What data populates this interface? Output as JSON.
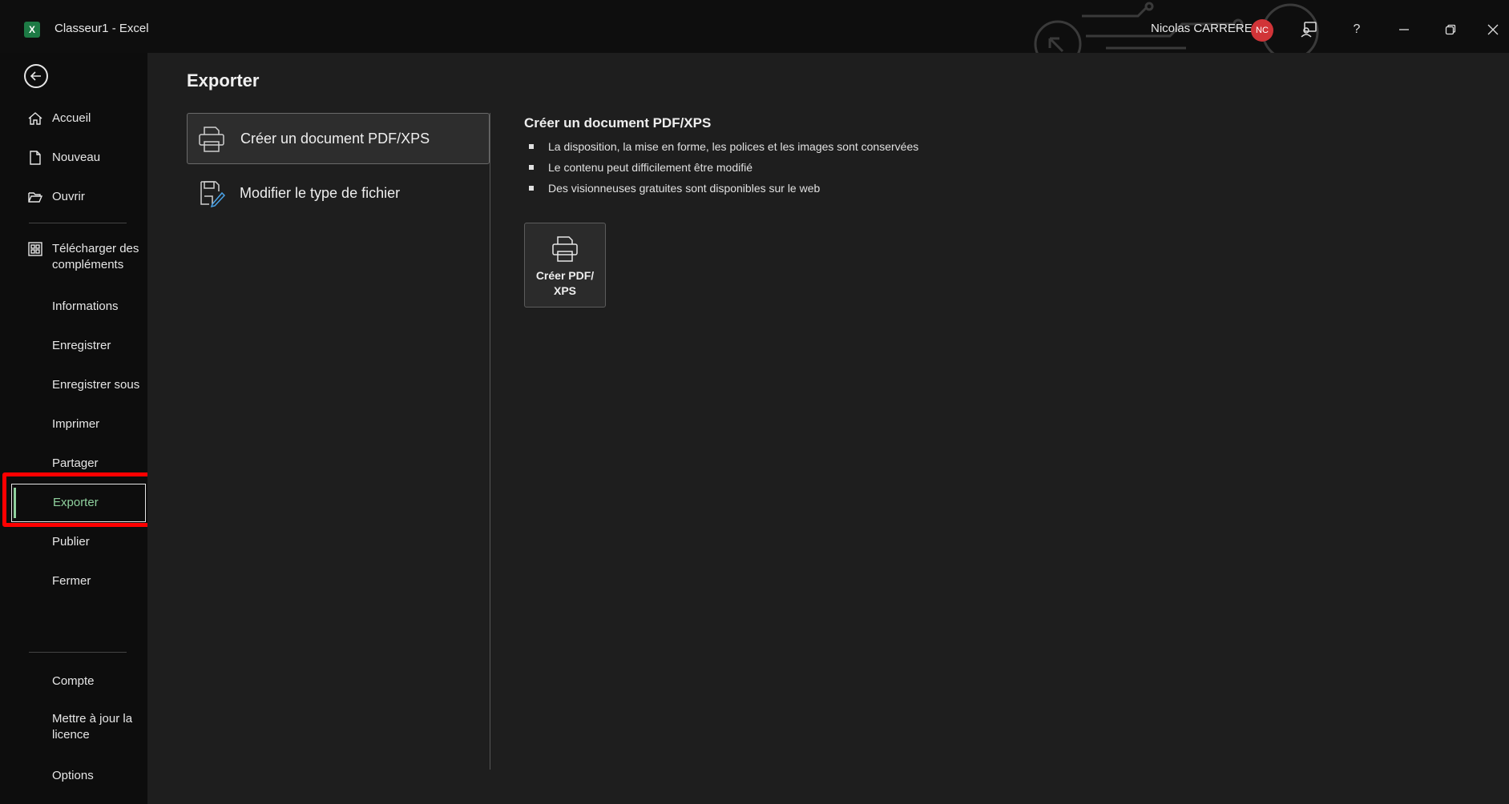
{
  "titlebar": {
    "app_logo": "X",
    "title": "Classeur1  -  Excel",
    "user_name": "Nicolas CARRERE",
    "avatar_initials": "NC",
    "help_label": "?"
  },
  "sidebar": {
    "items": [
      {
        "label": "Accueil",
        "icon": "home-icon"
      },
      {
        "label": "Nouveau",
        "icon": "new-document-icon"
      },
      {
        "label": "Ouvrir",
        "icon": "folder-open-icon"
      },
      {
        "label_line1": "Télécharger des",
        "label_line2": "compléments",
        "icon": "addins-icon"
      },
      {
        "label": "Informations"
      },
      {
        "label": "Enregistrer"
      },
      {
        "label": "Enregistrer sous"
      },
      {
        "label": "Imprimer"
      },
      {
        "label": "Partager"
      },
      {
        "label": "Exporter",
        "active": true
      },
      {
        "label": "Publier"
      },
      {
        "label": "Fermer"
      }
    ],
    "bottom_items": [
      {
        "label": "Compte"
      },
      {
        "label_line1": "Mettre à jour la",
        "label_line2": "licence"
      },
      {
        "label": "Options"
      }
    ]
  },
  "main": {
    "title": "Exporter",
    "options": [
      {
        "label": "Créer un document PDF/XPS",
        "icon": "printer-icon",
        "selected": true
      },
      {
        "label": "Modifier le type de fichier",
        "icon": "change-file-type-icon"
      }
    ],
    "detail": {
      "title": "Créer un document PDF/XPS",
      "bullets": [
        "La disposition, la mise en forme, les polices et les images sont conservées",
        "Le contenu peut difficilement être modifié",
        "Des visionneuses gratuites sont disponibles sur le web"
      ],
      "button_line1": "Créer PDF/",
      "button_line2": "XPS"
    }
  },
  "colors": {
    "accent_green": "#8fd19e",
    "highlight_red": "#ff0000",
    "avatar_red": "#d13438",
    "excel_green": "#1d7a45"
  }
}
